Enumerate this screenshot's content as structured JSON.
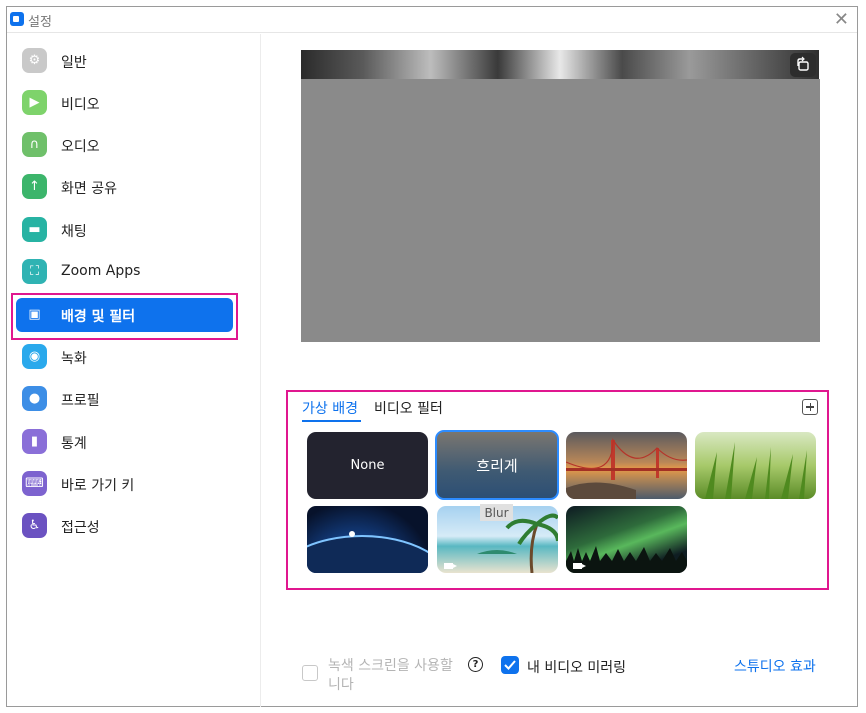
{
  "window": {
    "title": "설정",
    "close_glyph": "✕"
  },
  "sidebar": {
    "items": [
      {
        "label": "일반",
        "icon": "gear-icon",
        "color": "#c9c9c9",
        "glyph": "⚙"
      },
      {
        "label": "비디오",
        "icon": "video-camera-icon",
        "color": "#7ed36b",
        "glyph": "▶"
      },
      {
        "label": "오디오",
        "icon": "headphones-icon",
        "color": "#6fc06a",
        "glyph": "∩"
      },
      {
        "label": "화면 공유",
        "icon": "share-screen-icon",
        "color": "#3cb56b",
        "glyph": "↑"
      },
      {
        "label": "채팅",
        "icon": "chat-bubble-icon",
        "color": "#27b3a3",
        "glyph": "▬"
      },
      {
        "label": "Zoom Apps",
        "icon": "zoom-apps-icon",
        "color": "#2fb3b3",
        "glyph": "⛶"
      },
      {
        "label": "배경 및 필터",
        "icon": "background-filter-icon",
        "color": "#0e72ed",
        "glyph": "▣"
      },
      {
        "label": "녹화",
        "icon": "record-icon",
        "color": "#2aa9ec",
        "glyph": "◉"
      },
      {
        "label": "프로필",
        "icon": "profile-icon",
        "color": "#3d8ee6",
        "glyph": "●"
      },
      {
        "label": "통계",
        "icon": "statistics-icon",
        "color": "#8a6fd8",
        "glyph": "▮"
      },
      {
        "label": "바로 가기 키",
        "icon": "keyboard-icon",
        "color": "#7d63cf",
        "glyph": "⌨"
      },
      {
        "label": "접근성",
        "icon": "accessibility-icon",
        "color": "#6b52c1",
        "glyph": "♿"
      }
    ],
    "active_index": 6
  },
  "preview": {
    "rotate_icon": "rotate-camera-icon",
    "rotate_glyph": "⟲"
  },
  "backgrounds": {
    "tabs": {
      "virtual": "가상 배경",
      "filter": "비디오 필터"
    },
    "add_icon": "plus-icon",
    "none_label": "None",
    "blur_label": "흐리게",
    "blur_tooltip": "Blur",
    "thumbnails": [
      "None",
      "흐리게",
      "Golden Gate Bridge",
      "Grass",
      "Earth",
      "Beach",
      "Aurora"
    ]
  },
  "footer": {
    "green_screen_label": "녹색 스크린을 사용할 니다",
    "green_screen_checked": false,
    "help_glyph": "?",
    "mirror_label": "내 비디오 미러링",
    "mirror_checked": true,
    "studio_link": "스튜디오 효과"
  },
  "colors": {
    "accent": "#0e72ed",
    "highlight": "#e0178f"
  }
}
